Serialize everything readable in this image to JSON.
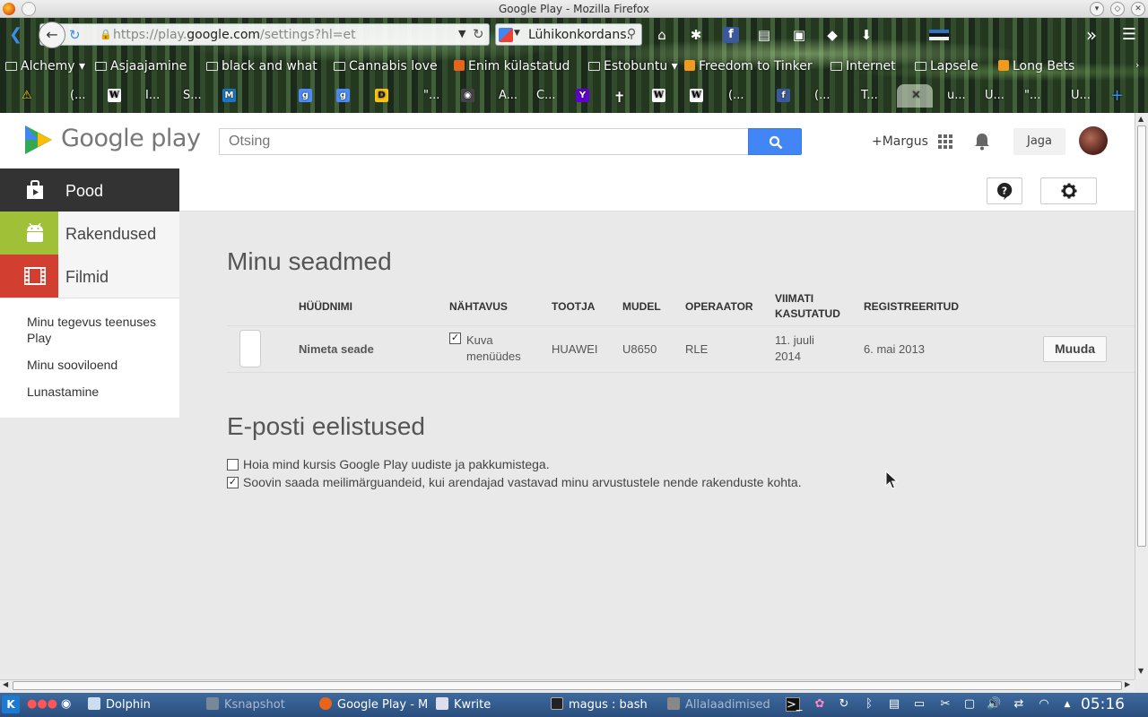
{
  "window": {
    "title": "Google Play - Mozilla Firefox"
  },
  "browser": {
    "url_prefix": "https://play.",
    "url_domain": "google.com",
    "url_suffix": "/settings?hl=et",
    "search_text": "Lühikonkordans."
  },
  "bookmarks": [
    "Alchemy",
    "Asjaajamine",
    "black and what",
    "Cannabis love",
    "Enim külastatud",
    "Estobuntu",
    "Freedom to Tinker",
    "Internet",
    "Lapsele",
    "Long Bets"
  ],
  "tabs": [
    "(...",
    "I...",
    "S...",
    "\"...",
    "A...",
    "C...",
    "(...",
    "(...",
    "T...",
    "u...",
    "U...",
    "\"...",
    "U..."
  ],
  "header": {
    "logo_text": "Google play",
    "search_placeholder": "Otsing",
    "user_link": "+Margus",
    "share_label": "Jaga"
  },
  "sidenav": {
    "categories": [
      "Pood",
      "Rakendused",
      "Filmid"
    ],
    "links": [
      "Minu tegevus teenuses Play",
      "Minu sooviloend",
      "Lunastamine"
    ]
  },
  "devices": {
    "title": "Minu seadmed",
    "columns": [
      "HÜÜDNIMI",
      "NÄHTAVUS",
      "TOOTJA",
      "MUDEL",
      "OPERAATOR",
      "VIIMATI KASUTATUD",
      "REGISTREERITUD"
    ],
    "rows": [
      {
        "nickname": "Nimeta seade",
        "visible_checked": true,
        "visibility": "Kuva menüüdes",
        "maker": "HUAWEI",
        "model": "U8650",
        "operator": "RLE",
        "last_used": "11. juuli 2014",
        "registered": "6. mai 2013",
        "edit_label": "Muuda"
      }
    ]
  },
  "email": {
    "title": "E-posti eelistused",
    "options": [
      {
        "label": "Hoia mind kursis Google Play uudiste ja pakkumistega.",
        "checked": false
      },
      {
        "label": "Soovin saada meilimärguandeid, kui arendajad vastavad minu arvustustele nende rakenduste kohta.",
        "checked": true
      }
    ]
  },
  "taskbar": {
    "items": [
      "Dolphin",
      "Ksnapshot",
      "Google Play - M",
      "Kwrite",
      "magus : bash",
      "Allalaadimised"
    ],
    "clock": "05:16"
  }
}
